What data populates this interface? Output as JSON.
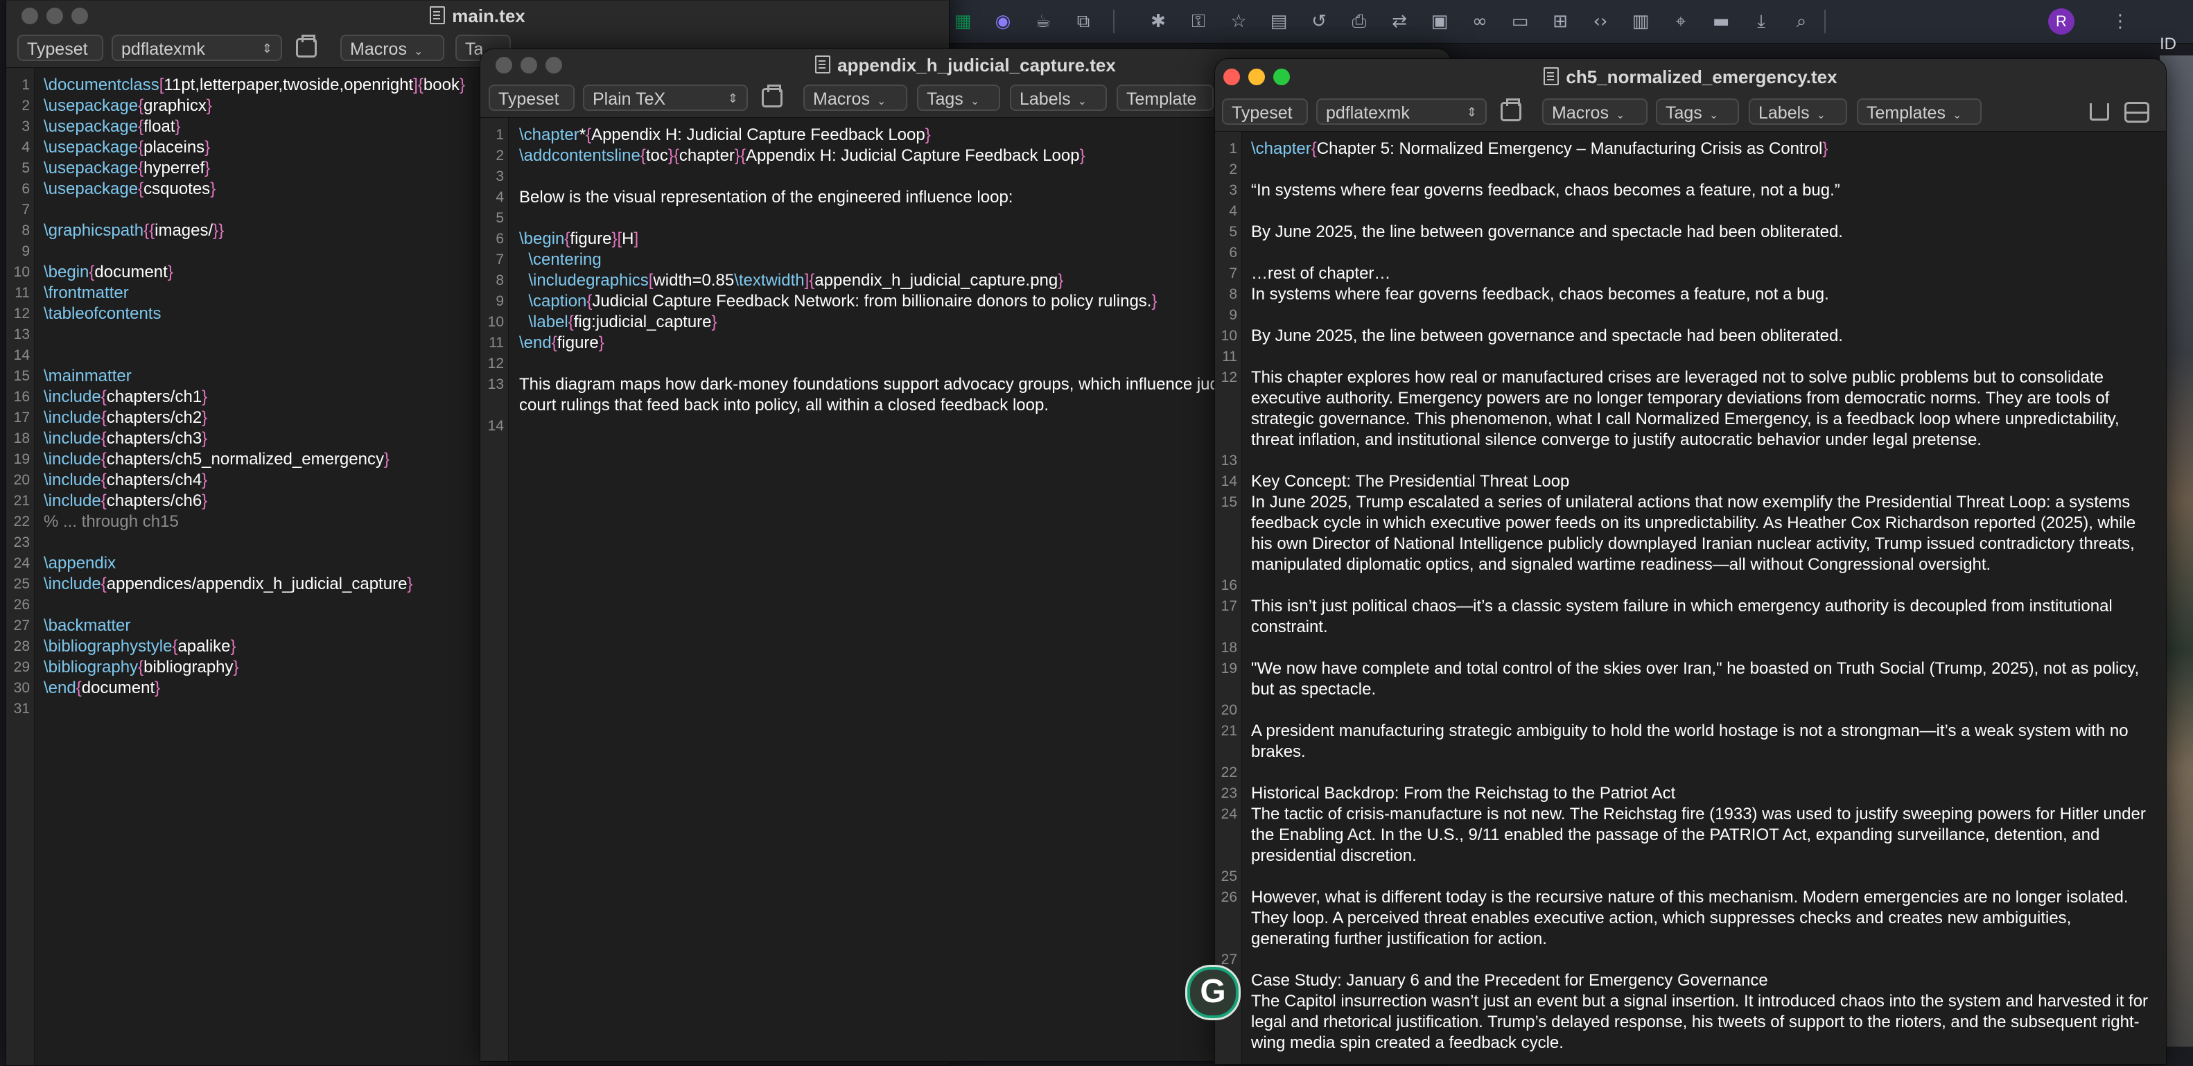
{
  "browser": {
    "profile_initial": "R",
    "partial_text": "ID",
    "icons": [
      "sheet-icon",
      "search-ext-icon",
      "coffee-icon",
      "puzzle-icon",
      "bug-icon",
      "key-icon",
      "star-icon",
      "notes-icon",
      "history-icon",
      "print-icon",
      "translate-icon",
      "qr-icon",
      "link-icon",
      "cast-icon",
      "grid-icon",
      "code-icon",
      "reader-icon",
      "location-icon",
      "card-icon",
      "download-icon",
      "screen-search-icon",
      "menu-kebab-icon"
    ]
  },
  "main_window": {
    "title": "main.tex",
    "toolbar": {
      "typeset": "Typeset",
      "engine": "pdflatexmk",
      "macros": "Macros",
      "tags_partial": "Ta"
    },
    "lines": [
      [
        [
          "cmd",
          "\\documentclass"
        ],
        [
          "brace",
          "["
        ],
        [
          "txt",
          "11pt,letterpaper,twoside,openright"
        ],
        [
          "brace",
          "]{"
        ],
        [
          "txt",
          "book"
        ],
        [
          "brace",
          "}"
        ]
      ],
      [
        [
          "cmd",
          "\\usepackage"
        ],
        [
          "brace",
          "{"
        ],
        [
          "txt",
          "graphicx"
        ],
        [
          "brace",
          "}"
        ]
      ],
      [
        [
          "cmd",
          "\\usepackage"
        ],
        [
          "brace",
          "{"
        ],
        [
          "txt",
          "float"
        ],
        [
          "brace",
          "}"
        ]
      ],
      [
        [
          "cmd",
          "\\usepackage"
        ],
        [
          "brace",
          "{"
        ],
        [
          "txt",
          "placeins"
        ],
        [
          "brace",
          "}"
        ]
      ],
      [
        [
          "cmd",
          "\\usepackage"
        ],
        [
          "brace",
          "{"
        ],
        [
          "txt",
          "hyperref"
        ],
        [
          "brace",
          "}"
        ]
      ],
      [
        [
          "cmd",
          "\\usepackage"
        ],
        [
          "brace",
          "{"
        ],
        [
          "txt",
          "csquotes"
        ],
        [
          "brace",
          "}"
        ]
      ],
      [],
      [
        [
          "cmd",
          "\\graphicspath"
        ],
        [
          "brace",
          "{{"
        ],
        [
          "txt",
          "images/"
        ],
        [
          "brace",
          "}}"
        ]
      ],
      [],
      [
        [
          "cmd",
          "\\begin"
        ],
        [
          "brace",
          "{"
        ],
        [
          "txt",
          "document"
        ],
        [
          "brace",
          "}"
        ]
      ],
      [
        [
          "cmd",
          "\\frontmatter"
        ]
      ],
      [
        [
          "cmd",
          "\\tableofcontents"
        ]
      ],
      [],
      [],
      [
        [
          "cmd",
          "\\mainmatter"
        ]
      ],
      [
        [
          "cmd",
          "\\include"
        ],
        [
          "brace",
          "{"
        ],
        [
          "txt",
          "chapters/ch1"
        ],
        [
          "brace",
          "}"
        ]
      ],
      [
        [
          "cmd",
          "\\include"
        ],
        [
          "brace",
          "{"
        ],
        [
          "txt",
          "chapters/ch2"
        ],
        [
          "brace",
          "}"
        ]
      ],
      [
        [
          "cmd",
          "\\include"
        ],
        [
          "brace",
          "{"
        ],
        [
          "txt",
          "chapters/ch3"
        ],
        [
          "brace",
          "}"
        ]
      ],
      [
        [
          "cmd",
          "\\include"
        ],
        [
          "brace",
          "{"
        ],
        [
          "txt",
          "chapters/ch5_normalized_emergency"
        ],
        [
          "brace",
          "}"
        ]
      ],
      [
        [
          "cmd",
          "\\include"
        ],
        [
          "brace",
          "{"
        ],
        [
          "txt",
          "chapters/ch4"
        ],
        [
          "brace",
          "}"
        ]
      ],
      [
        [
          "cmd",
          "\\include"
        ],
        [
          "brace",
          "{"
        ],
        [
          "txt",
          "chapters/ch6"
        ],
        [
          "brace",
          "}"
        ]
      ],
      [
        [
          "comment",
          "% ... through ch15"
        ]
      ],
      [],
      [
        [
          "cmd",
          "\\appendix"
        ]
      ],
      [
        [
          "cmd",
          "\\include"
        ],
        [
          "brace",
          "{"
        ],
        [
          "txt",
          "appendices/appendix_h_judicial_capture"
        ],
        [
          "brace",
          "}"
        ]
      ],
      [],
      [
        [
          "cmd",
          "\\backmatter"
        ]
      ],
      [
        [
          "cmd",
          "\\bibliographystyle"
        ],
        [
          "brace",
          "{"
        ],
        [
          "txt",
          "apalike"
        ],
        [
          "brace",
          "}"
        ]
      ],
      [
        [
          "cmd",
          "\\bibliography"
        ],
        [
          "brace",
          "{"
        ],
        [
          "txt",
          "bibliography"
        ],
        [
          "brace",
          "}"
        ]
      ],
      [
        [
          "cmd",
          "\\end"
        ],
        [
          "brace",
          "{"
        ],
        [
          "txt",
          "document"
        ],
        [
          "brace",
          "}"
        ]
      ],
      []
    ]
  },
  "appendix_window": {
    "title": "appendix_h_judicial_capture.tex",
    "toolbar": {
      "typeset": "Typeset",
      "engine": "Plain TeX",
      "macros": "Macros",
      "tags": "Tags",
      "labels": "Labels",
      "templates_partial": "Template"
    },
    "rows": [
      {
        "n": "1",
        "segs": [
          [
            "cmd",
            "\\chapter"
          ],
          [
            "txt",
            "*"
          ],
          [
            "brace",
            "{"
          ],
          [
            "txt",
            "Appendix H: Judicial Capture Feedback Loop"
          ],
          [
            "brace",
            "}"
          ]
        ]
      },
      {
        "n": "2",
        "segs": [
          [
            "cmd",
            "\\addcontentsline"
          ],
          [
            "brace",
            "{"
          ],
          [
            "txt",
            "toc"
          ],
          [
            "brace",
            "}{"
          ],
          [
            "txt",
            "chapter"
          ],
          [
            "brace",
            "}{"
          ],
          [
            "txt",
            "Appendix H: Judicial Capture Feedback Loop"
          ],
          [
            "brace",
            "}"
          ]
        ]
      },
      {
        "n": "3",
        "segs": []
      },
      {
        "n": "4",
        "segs": [
          [
            "txt",
            "Below is the visual representation of the engineered influence loop:"
          ]
        ]
      },
      {
        "n": "5",
        "segs": []
      },
      {
        "n": "6",
        "segs": [
          [
            "cmd",
            "\\begin"
          ],
          [
            "brace",
            "{"
          ],
          [
            "txt",
            "figure"
          ],
          [
            "brace",
            "}["
          ],
          [
            "txt",
            "H"
          ],
          [
            "brace",
            "]"
          ]
        ]
      },
      {
        "n": "7",
        "segs": [
          [
            "txt",
            "  "
          ],
          [
            "cmd",
            "\\centering"
          ]
        ]
      },
      {
        "n": "8",
        "segs": [
          [
            "txt",
            "  "
          ],
          [
            "cmd",
            "\\includegraphics"
          ],
          [
            "brace",
            "["
          ],
          [
            "txt",
            "width=0.85"
          ],
          [
            "cmd",
            "\\textwidth"
          ],
          [
            "brace",
            "]{"
          ],
          [
            "txt",
            "appendix_h_judicial_capture.png"
          ],
          [
            "brace",
            "}"
          ]
        ]
      },
      {
        "n": "9",
        "segs": [
          [
            "txt",
            "  "
          ],
          [
            "cmd",
            "\\caption"
          ],
          [
            "brace",
            "{"
          ],
          [
            "txt",
            "Judicial Capture Feedback Network: from billionaire donors to policy rulings."
          ],
          [
            "brace",
            "}"
          ]
        ]
      },
      {
        "n": "10",
        "segs": [
          [
            "txt",
            "  "
          ],
          [
            "cmd",
            "\\label"
          ],
          [
            "brace",
            "{"
          ],
          [
            "txt",
            "fig:judicial_capture"
          ],
          [
            "brace",
            "}"
          ]
        ]
      },
      {
        "n": "11",
        "segs": [
          [
            "cmd",
            "\\end"
          ],
          [
            "brace",
            "{"
          ],
          [
            "txt",
            "figure"
          ],
          [
            "brace",
            "}"
          ]
        ]
      },
      {
        "n": "12",
        "segs": []
      },
      {
        "n": "13",
        "segs": [
          [
            "txt",
            "This diagram maps how dark-money foundations support advocacy groups, which influence judicial appointments,"
          ]
        ]
      },
      {
        "n": "",
        "segs": [
          [
            "txt",
            "court rulings that feed back into policy, all within a closed feedback loop."
          ]
        ]
      },
      {
        "n": "14",
        "segs": []
      }
    ]
  },
  "ch5_window": {
    "title": "ch5_normalized_emergency.tex",
    "toolbar": {
      "typeset": "Typeset",
      "engine": "pdflatexmk",
      "macros": "Macros",
      "tags": "Tags",
      "labels": "Labels",
      "templates": "Templates"
    },
    "paragraphs": [
      {
        "n": "1",
        "rows": 1,
        "segs": [
          [
            "cmd",
            "\\chapter"
          ],
          [
            "brace",
            "{"
          ],
          [
            "txt",
            "Chapter 5: Normalized Emergency – Manufacturing Crisis as Control"
          ],
          [
            "brace",
            "}"
          ]
        ]
      },
      {
        "n": "2",
        "rows": 1,
        "segs": []
      },
      {
        "n": "3",
        "rows": 1,
        "segs": [
          [
            "txt",
            "“In systems where fear governs feedback, chaos becomes a feature, not a bug.”"
          ]
        ]
      },
      {
        "n": "4",
        "rows": 1,
        "segs": []
      },
      {
        "n": "5",
        "rows": 1,
        "segs": [
          [
            "txt",
            "By June 2025, the line between governance and spectacle had been obliterated."
          ]
        ]
      },
      {
        "n": "6",
        "rows": 1,
        "segs": []
      },
      {
        "n": "7",
        "rows": 1,
        "segs": [
          [
            "txt",
            "…rest of chapter…"
          ]
        ]
      },
      {
        "n": "8",
        "rows": 1,
        "segs": [
          [
            "txt",
            "In systems where fear governs feedback, chaos becomes a feature, not a bug."
          ]
        ]
      },
      {
        "n": "9",
        "rows": 1,
        "segs": []
      },
      {
        "n": "10",
        "rows": 1,
        "segs": [
          [
            "txt",
            "By June 2025, the line between governance and spectacle had been obliterated."
          ]
        ]
      },
      {
        "n": "11",
        "rows": 1,
        "segs": []
      },
      {
        "n": "12",
        "rows": 4,
        "segs": [
          [
            "txt",
            "This chapter explores how real or manufactured crises are leveraged not to solve public problems but to consolidate executive authority. Emergency powers are no longer temporary deviations from democratic norms. They are tools of strategic governance. This phenomenon, what I call Normalized Emergency, is a feedback loop where unpredictability, threat inflation, and institutional silence converge to justify autocratic behavior under legal pretense."
          ]
        ]
      },
      {
        "n": "13",
        "rows": 1,
        "segs": []
      },
      {
        "n": "14",
        "rows": 1,
        "segs": [
          [
            "txt",
            "Key Concept: The Presidential Threat Loop"
          ]
        ]
      },
      {
        "n": "15",
        "rows": 4,
        "segs": [
          [
            "txt",
            "In June 2025, Trump escalated a series of unilateral actions that now exemplify the Presidential Threat Loop: a systems feedback cycle in which executive power feeds on its unpredictability. As Heather Cox Richardson reported (2025), while his own Director of National Intelligence publicly downplayed Iranian nuclear activity, Trump issued contradictory threats, manipulated diplomatic optics, and signaled wartime readiness—all without Congressional oversight."
          ]
        ]
      },
      {
        "n": "16",
        "rows": 1,
        "segs": []
      },
      {
        "n": "17",
        "rows": 2,
        "segs": [
          [
            "txt",
            "This isn’t just political chaos—it’s a classic system failure in which emergency authority is decoupled from institutional constraint."
          ]
        ]
      },
      {
        "n": "18",
        "rows": 1,
        "segs": []
      },
      {
        "n": "19",
        "rows": 2,
        "segs": [
          [
            "txt",
            "\"We now have complete and total control of the skies over Iran,\" he boasted on Truth Social (Trump, 2025), not as policy, but as spectacle."
          ]
        ]
      },
      {
        "n": "20",
        "rows": 1,
        "segs": []
      },
      {
        "n": "21",
        "rows": 2,
        "segs": [
          [
            "txt",
            "A president manufacturing strategic ambiguity to hold the world hostage is not a strongman—it’s a weak system with no brakes."
          ]
        ]
      },
      {
        "n": "22",
        "rows": 1,
        "segs": []
      },
      {
        "n": "23",
        "rows": 1,
        "segs": [
          [
            "txt",
            "Historical Backdrop: From the Reichstag to the Patriot Act"
          ]
        ]
      },
      {
        "n": "24",
        "rows": 3,
        "segs": [
          [
            "txt",
            "The tactic of crisis-manufacture is not new. The Reichstag fire (1933) was used to justify sweeping powers for Hitler under the Enabling Act. In the U.S., 9/11 enabled the passage of the PATRIOT Act, expanding surveillance, detention, and presidential discretion."
          ]
        ]
      },
      {
        "n": "25",
        "rows": 1,
        "segs": []
      },
      {
        "n": "26",
        "rows": 3,
        "segs": [
          [
            "txt",
            "However, what is different today is the recursive nature of this mechanism. Modern emergencies are no longer isolated. They loop. A perceived threat enables executive action, which suppresses checks and creates new ambiguities, generating further justification for action."
          ]
        ]
      },
      {
        "n": "27",
        "rows": 1,
        "segs": []
      },
      {
        "n": "",
        "rows": 1,
        "segs": [
          [
            "txt",
            "Case Study: January 6 and the Precedent for Emergency Governance"
          ]
        ]
      },
      {
        "n": "",
        "rows": 3,
        "segs": [
          [
            "txt",
            "The Capitol insurrection wasn’t just an event but a signal insertion. It introduced chaos into the system and harvested it for legal and rhetorical justification. Trump’s delayed response, his tweets of support to the rioters, and the subsequent right-wing media spin created a feedback cycle."
          ]
        ]
      }
    ]
  },
  "grammarly": {
    "letter": "G"
  }
}
